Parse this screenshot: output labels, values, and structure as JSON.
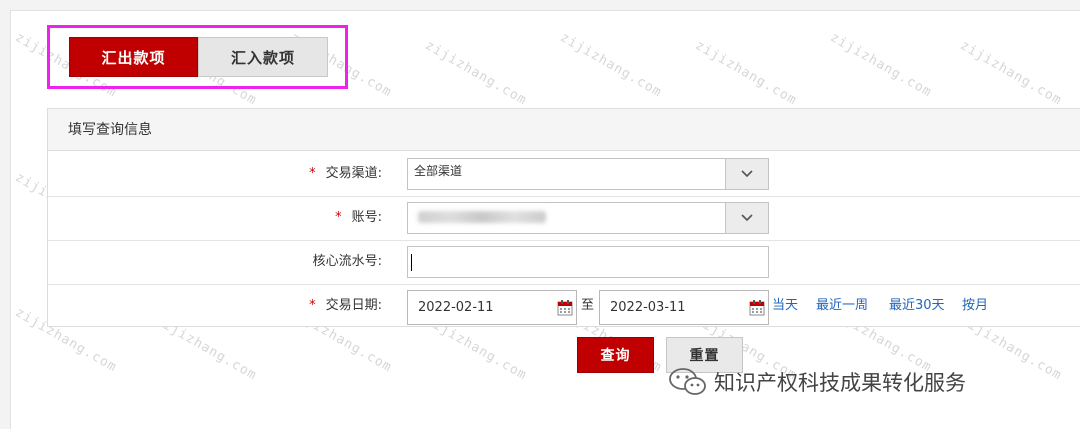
{
  "tabs": [
    {
      "label": "汇出款项",
      "active": true
    },
    {
      "label": "汇入款项",
      "active": false
    }
  ],
  "panel": {
    "title": "填写查询信息",
    "fields": {
      "channel": {
        "label": "交易渠道:",
        "required": true,
        "value": "全部渠道"
      },
      "account": {
        "label": "账号:",
        "required": true,
        "value": ""
      },
      "core_serial": {
        "label": "核心流水号:",
        "required": false,
        "value": ""
      },
      "date": {
        "label": "交易日期:",
        "required": true,
        "start": "2022-02-11",
        "separator": "至",
        "end": "2022-03-11",
        "quick_links": [
          "当天",
          "最近一周",
          "最近30天",
          "按月"
        ]
      }
    },
    "required_mark": "*"
  },
  "buttons": {
    "query": "查询",
    "reset": "重置"
  },
  "watermark": "zijizhang.com",
  "brand": "知识产权科技成果转化服务",
  "colors": {
    "accent": "#c00000",
    "highlight": "#ee22ee",
    "link": "#2266bb"
  }
}
